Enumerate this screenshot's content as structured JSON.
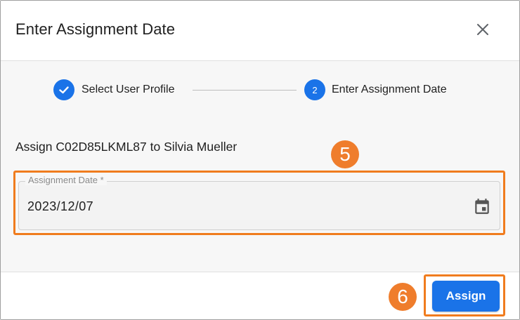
{
  "dialog": {
    "title": "Enter Assignment Date",
    "close_icon": "close-icon"
  },
  "stepper": {
    "steps": [
      {
        "number": "1",
        "label": "Select User Profile",
        "state": "completed",
        "icon": "check-icon"
      },
      {
        "number": "2",
        "label": "Enter Assignment Date",
        "state": "active"
      }
    ]
  },
  "assignment": {
    "text": "Assign C02D85LKML87 to Silvia Mueller"
  },
  "date_field": {
    "label": "Assignment Date *",
    "value": "2023/12/07",
    "icon": "calendar-icon"
  },
  "annotations": {
    "step_5": "5",
    "step_6": "6",
    "highlight_color": "#f07c1e"
  },
  "footer": {
    "assign_label": "Assign"
  },
  "colors": {
    "primary": "#1a73e8",
    "badge": "#ef7d2c"
  }
}
